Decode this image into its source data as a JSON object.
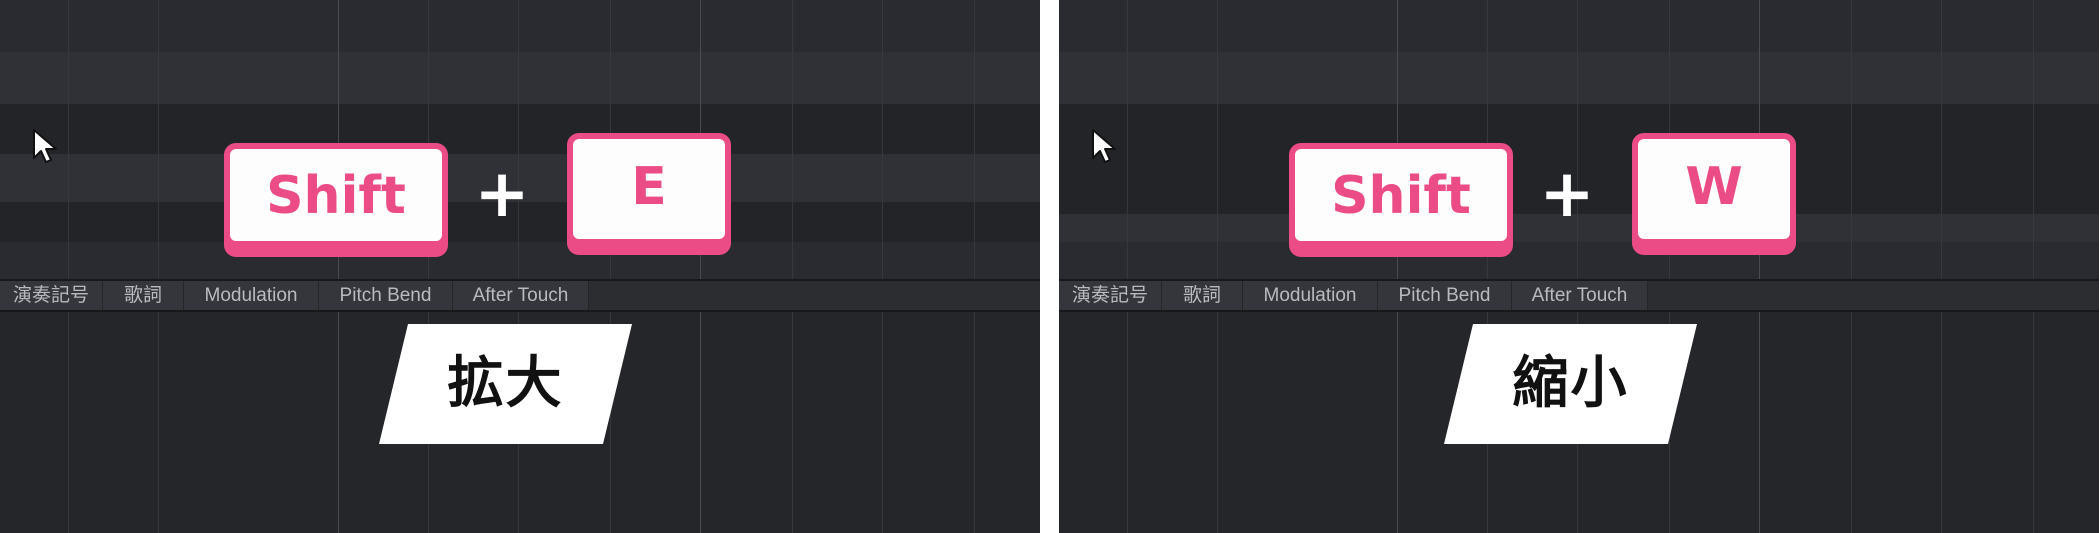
{
  "panels": [
    {
      "tabs": [
        "演奏記号",
        "歌詞",
        "Modulation",
        "Pitch Bend",
        "After Touch"
      ],
      "shortcut": {
        "modifier": "Shift",
        "joiner": "+",
        "key": "E"
      },
      "caption": "拡大"
    },
    {
      "tabs": [
        "演奏記号",
        "歌詞",
        "Modulation",
        "Pitch Bend",
        "After Touch"
      ],
      "shortcut": {
        "modifier": "Shift",
        "joiner": "+",
        "key": "W"
      },
      "caption": "縮小"
    }
  ],
  "colors": {
    "accent": "#ec4c86",
    "keycap_face": "#fdfdfd",
    "background": "#28292d",
    "caption_bg": "#ffffff",
    "caption_text": "#111111"
  },
  "icons": {
    "pointer": "mouse-pointer-icon"
  }
}
